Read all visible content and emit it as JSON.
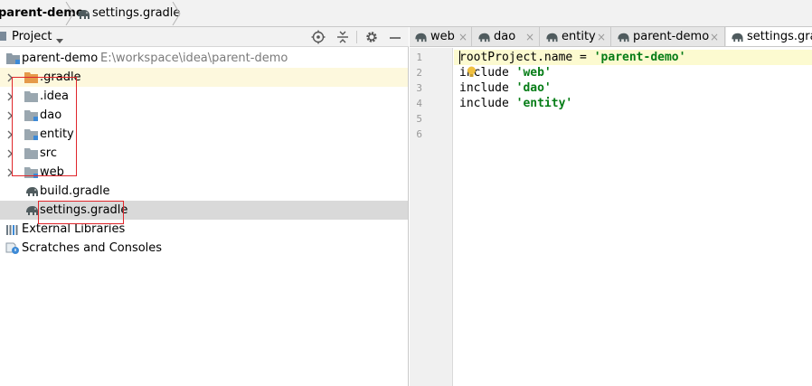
{
  "breadcrumb": {
    "project": "parent-demo",
    "file": "settings.gradle"
  },
  "project_panel": {
    "title": "Project",
    "toolbar_icons": [
      "locate-icon",
      "collapse-icon",
      "gear-icon",
      "minimize-icon"
    ],
    "root": {
      "label": "parent-demo",
      "path": "E:\\workspace\\idea\\parent-demo"
    },
    "items": [
      {
        "label": ".gradle",
        "kind": "folder-orange",
        "expandable": true
      },
      {
        "label": ".idea",
        "kind": "folder",
        "expandable": true
      },
      {
        "label": "dao",
        "kind": "module-folder",
        "expandable": true
      },
      {
        "label": "entity",
        "kind": "module-folder",
        "expandable": true
      },
      {
        "label": "src",
        "kind": "folder",
        "expandable": true
      },
      {
        "label": "web",
        "kind": "module-folder",
        "expandable": true
      },
      {
        "label": "build.gradle",
        "kind": "gradle-file",
        "expandable": false
      },
      {
        "label": "settings.gradle",
        "kind": "gradle-file",
        "expandable": false,
        "selected": true
      }
    ],
    "external_libraries": "External Libraries",
    "scratches": "Scratches and Consoles"
  },
  "editor": {
    "tabs": [
      {
        "label": "web",
        "active": false
      },
      {
        "label": "dao",
        "active": false
      },
      {
        "label": "entity",
        "active": false
      },
      {
        "label": "parent-demo",
        "active": false
      },
      {
        "label": "settings.grad",
        "active": true
      }
    ],
    "tab_close_glyph": "×",
    "line_numbers": [
      "1",
      "2",
      "3",
      "4",
      "5",
      "6"
    ],
    "lines": [
      {
        "code": "rootProject.name = ",
        "string": "'parent-demo'"
      },
      {
        "code": "include ",
        "string": "'web'"
      },
      {
        "code": "include ",
        "string": "'dao'"
      },
      {
        "code": "include ",
        "string": "'entity'"
      }
    ]
  },
  "colors": {
    "highlight_box": "#e0262b",
    "string": "#067d17",
    "selection": "#d9d9d9",
    "current_line": "#fcfad0"
  }
}
